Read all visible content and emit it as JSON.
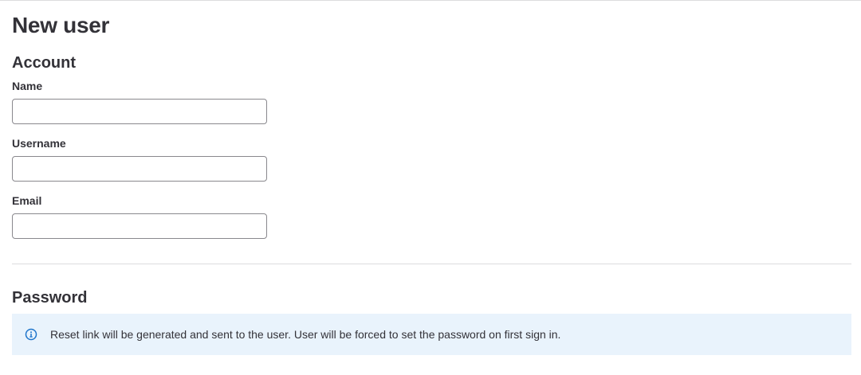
{
  "page": {
    "title": "New user"
  },
  "account": {
    "title": "Account",
    "fields": [
      {
        "label": "Name",
        "value": "",
        "placeholder": ""
      },
      {
        "label": "Username",
        "value": "",
        "placeholder": ""
      },
      {
        "label": "Email",
        "value": "",
        "placeholder": ""
      }
    ]
  },
  "password": {
    "title": "Password",
    "alert": {
      "icon": "info-icon",
      "text": "Reset link will be generated and sent to the user. User will be forced to set the password on first sign in.",
      "color": "#1f75cb",
      "background": "#e9f3fc"
    }
  }
}
